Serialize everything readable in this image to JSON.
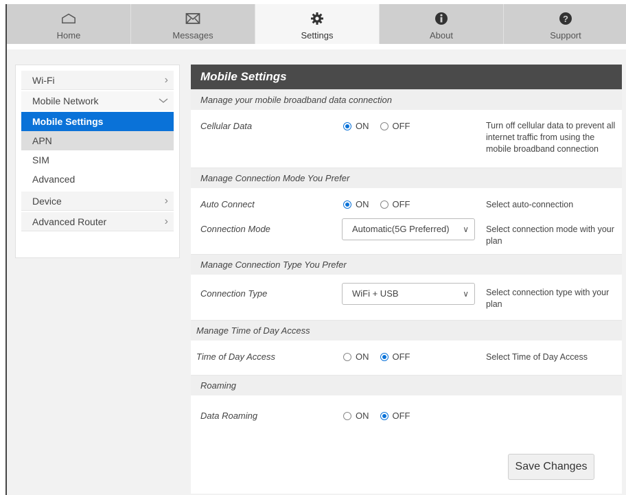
{
  "nav": {
    "tabs": [
      {
        "label": "Home",
        "icon": "home-icon"
      },
      {
        "label": "Messages",
        "icon": "envelope-icon"
      },
      {
        "label": "Settings",
        "icon": "gear-icon",
        "active": true
      },
      {
        "label": "About",
        "icon": "info-icon"
      },
      {
        "label": "Support",
        "icon": "help-icon"
      }
    ]
  },
  "sidebar": {
    "wifi": "Wi-Fi",
    "mobile_network": "Mobile Network",
    "mobile_settings": "Mobile Settings",
    "apn": "APN",
    "sim": "SIM",
    "advanced": "Advanced",
    "device": "Device",
    "advanced_router": "Advanced Router"
  },
  "main": {
    "title": "Mobile Settings",
    "section_data": "Manage your mobile broadband data connection",
    "cellular_label": "Cellular Data",
    "cellular_value": "ON",
    "cellular_desc": "Turn off cellular data to prevent all internet traffic from using the mobile broadband connection",
    "section_mode": "Manage Connection Mode You Prefer",
    "auto_label": "Auto Connect",
    "auto_value": "ON",
    "auto_desc": "Select auto-connection",
    "mode_label": "Connection Mode",
    "mode_value": "Automatic(5G Preferred)",
    "mode_desc": "Select connection mode with your plan",
    "section_type": "Manage Connection Type You Prefer",
    "type_label": "Connection Type",
    "type_value": "WiFi + USB",
    "type_desc": "Select connection type with your plan",
    "section_tod": "Manage Time of Day Access",
    "tod_label": "Time of Day Access",
    "tod_value": "OFF",
    "tod_desc": "Select Time of Day Access",
    "section_roaming": "Roaming",
    "roaming_label": "Data Roaming",
    "roaming_value": "OFF",
    "on_label": "ON",
    "off_label": "OFF",
    "save_label": "Save Changes"
  },
  "colors": {
    "accent": "#0a72d8",
    "header_bg": "#4a4a4a",
    "nav_bg": "#cfcfcf"
  }
}
